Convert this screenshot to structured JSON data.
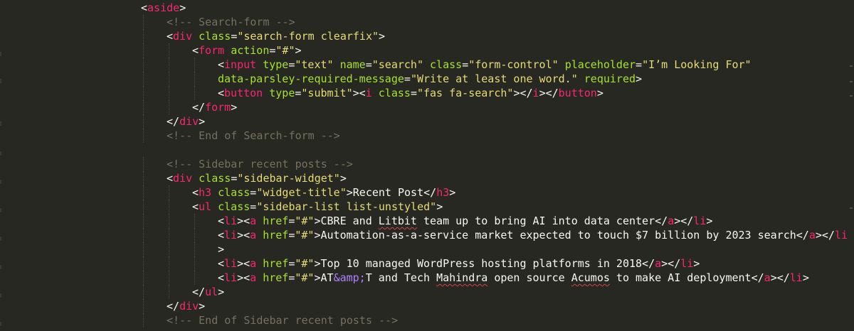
{
  "editor": {
    "theme_colors": {
      "background": "#272822",
      "tag": "#f92672",
      "attribute": "#a6e22e",
      "string": "#e6db74",
      "comment": "#75715e",
      "entity": "#ae81ff",
      "punctuation": "#f8f8f2"
    },
    "lines": [
      {
        "indent": 0,
        "tokens": [
          [
            "p",
            "<"
          ],
          [
            "t",
            "aside"
          ],
          [
            "p",
            ">"
          ]
        ]
      },
      {
        "indent": 1,
        "tokens": [
          [
            "c",
            "<!-- Search-form -->"
          ]
        ]
      },
      {
        "indent": 1,
        "tokens": [
          [
            "p",
            "<"
          ],
          [
            "t",
            "div"
          ],
          [
            "p",
            " "
          ],
          [
            "a",
            "class"
          ],
          [
            "p",
            "="
          ],
          [
            "s",
            "\"search-form clearfix\""
          ],
          [
            "p",
            ">"
          ]
        ]
      },
      {
        "indent": 2,
        "tokens": [
          [
            "p",
            "<"
          ],
          [
            "t",
            "form"
          ],
          [
            "p",
            " "
          ],
          [
            "a",
            "action"
          ],
          [
            "p",
            "="
          ],
          [
            "s",
            "\"#\""
          ],
          [
            "p",
            ">"
          ]
        ]
      },
      {
        "indent": 3,
        "tokens": [
          [
            "p",
            "<"
          ],
          [
            "t",
            "input"
          ],
          [
            "p",
            " "
          ],
          [
            "a",
            "type"
          ],
          [
            "p",
            "="
          ],
          [
            "s",
            "\"text\""
          ],
          [
            "p",
            " "
          ],
          [
            "a",
            "name"
          ],
          [
            "p",
            "="
          ],
          [
            "s",
            "\"search\""
          ],
          [
            "p",
            " "
          ],
          [
            "a",
            "class"
          ],
          [
            "p",
            "="
          ],
          [
            "s",
            "\"form-control\""
          ],
          [
            "p",
            " "
          ],
          [
            "a",
            "placeholder"
          ],
          [
            "p",
            "="
          ],
          [
            "s",
            "\"I’m Looking For\""
          ]
        ]
      },
      {
        "indent": 3,
        "tokens": [
          [
            "a",
            "data-parsley-required-message"
          ],
          [
            "p",
            "="
          ],
          [
            "s",
            "\"Write at least one word.\""
          ],
          [
            "p",
            " "
          ],
          [
            "a",
            "required"
          ],
          [
            "p",
            ">"
          ]
        ]
      },
      {
        "indent": 3,
        "tokens": [
          [
            "p",
            "<"
          ],
          [
            "t",
            "button"
          ],
          [
            "p",
            " "
          ],
          [
            "a",
            "type"
          ],
          [
            "p",
            "="
          ],
          [
            "s",
            "\"submit\""
          ],
          [
            "p",
            "><"
          ],
          [
            "t",
            "i"
          ],
          [
            "p",
            " "
          ],
          [
            "a",
            "class"
          ],
          [
            "p",
            "="
          ],
          [
            "s",
            "\"fas fa-search\""
          ],
          [
            "p",
            "></"
          ],
          [
            "t",
            "i"
          ],
          [
            "p",
            "></"
          ],
          [
            "t",
            "button"
          ],
          [
            "p",
            ">"
          ]
        ]
      },
      {
        "indent": 2,
        "tokens": [
          [
            "p",
            "</"
          ],
          [
            "t",
            "form"
          ],
          [
            "p",
            ">"
          ]
        ]
      },
      {
        "indent": 1,
        "tokens": [
          [
            "p",
            "</"
          ],
          [
            "t",
            "div"
          ],
          [
            "p",
            ">"
          ]
        ]
      },
      {
        "indent": 1,
        "tokens": [
          [
            "c",
            "<!-- End of Search-form -->"
          ]
        ]
      },
      {
        "indent": 0,
        "tokens": []
      },
      {
        "indent": 1,
        "tokens": [
          [
            "c",
            "<!-- Sidebar recent posts -->"
          ]
        ]
      },
      {
        "indent": 1,
        "tokens": [
          [
            "p",
            "<"
          ],
          [
            "t",
            "div"
          ],
          [
            "p",
            " "
          ],
          [
            "a",
            "class"
          ],
          [
            "p",
            "="
          ],
          [
            "s",
            "\"sidebar-widget\""
          ],
          [
            "p",
            ">"
          ]
        ]
      },
      {
        "indent": 2,
        "tokens": [
          [
            "p",
            "<"
          ],
          [
            "t",
            "h3"
          ],
          [
            "p",
            " "
          ],
          [
            "a",
            "class"
          ],
          [
            "p",
            "="
          ],
          [
            "s",
            "\"widget-title\""
          ],
          [
            "p",
            ">Recent Post</"
          ],
          [
            "t",
            "h3"
          ],
          [
            "p",
            ">"
          ]
        ]
      },
      {
        "indent": 2,
        "tokens": [
          [
            "p",
            "<"
          ],
          [
            "t",
            "ul"
          ],
          [
            "p",
            " "
          ],
          [
            "a",
            "class"
          ],
          [
            "p",
            "="
          ],
          [
            "s",
            "\"sidebar-list list-unstyled\""
          ],
          [
            "p",
            ">"
          ]
        ]
      },
      {
        "indent": 3,
        "tokens": [
          [
            "p",
            "<"
          ],
          [
            "t",
            "li"
          ],
          [
            "p",
            "><"
          ],
          [
            "t",
            "a"
          ],
          [
            "p",
            " "
          ],
          [
            "a",
            "href"
          ],
          [
            "p",
            "="
          ],
          [
            "s",
            "\"#\""
          ],
          [
            "p",
            ">CBRE and "
          ],
          [
            "pw",
            "Litbit"
          ],
          [
            "p",
            " team up to bring AI into data center</"
          ],
          [
            "t",
            "a"
          ],
          [
            "p",
            "></"
          ],
          [
            "t",
            "li"
          ],
          [
            "p",
            ">"
          ]
        ]
      },
      {
        "indent": 3,
        "tokens": [
          [
            "p",
            "<"
          ],
          [
            "t",
            "li"
          ],
          [
            "p",
            "><"
          ],
          [
            "t",
            "a"
          ],
          [
            "p",
            " "
          ],
          [
            "a",
            "href"
          ],
          [
            "p",
            "="
          ],
          [
            "s",
            "\"#\""
          ],
          [
            "p",
            ">Automation-as-a-service market expected to touch $7 billion by 2023 search</"
          ],
          [
            "t",
            "a"
          ],
          [
            "p",
            "></"
          ],
          [
            "t",
            "li"
          ]
        ]
      },
      {
        "indent": 3,
        "tokens": [
          [
            "p",
            ">"
          ]
        ]
      },
      {
        "indent": 3,
        "tokens": [
          [
            "p",
            "<"
          ],
          [
            "t",
            "li"
          ],
          [
            "p",
            "><"
          ],
          [
            "t",
            "a"
          ],
          [
            "p",
            " "
          ],
          [
            "a",
            "href"
          ],
          [
            "p",
            "="
          ],
          [
            "s",
            "\"#\""
          ],
          [
            "p",
            ">Top 10 managed WordPress hosting platforms in 2018</"
          ],
          [
            "t",
            "a"
          ],
          [
            "p",
            "></"
          ],
          [
            "t",
            "li"
          ],
          [
            "p",
            ">"
          ]
        ]
      },
      {
        "indent": 3,
        "tokens": [
          [
            "p",
            "<"
          ],
          [
            "t",
            "li"
          ],
          [
            "p",
            "><"
          ],
          [
            "t",
            "a"
          ],
          [
            "p",
            " "
          ],
          [
            "a",
            "href"
          ],
          [
            "p",
            "="
          ],
          [
            "s",
            "\"#\""
          ],
          [
            "p",
            ">AT"
          ],
          [
            "e",
            "&amp;"
          ],
          [
            "p",
            "T and Tech "
          ],
          [
            "pw",
            "Mahindra"
          ],
          [
            "p",
            " open source "
          ],
          [
            "pw",
            "Acumos"
          ],
          [
            "p",
            " to make AI deployment</"
          ],
          [
            "t",
            "a"
          ],
          [
            "p",
            "></"
          ],
          [
            "t",
            "li"
          ],
          [
            "p",
            ">"
          ]
        ]
      },
      {
        "indent": 2,
        "tokens": [
          [
            "p",
            "</"
          ],
          [
            "t",
            "ul"
          ],
          [
            "p",
            ">"
          ]
        ]
      },
      {
        "indent": 1,
        "tokens": [
          [
            "p",
            "</"
          ],
          [
            "t",
            "div"
          ],
          [
            "p",
            ">"
          ]
        ]
      },
      {
        "indent": 1,
        "tokens": [
          [
            "c",
            "<!-- End of Sidebar recent posts -->"
          ]
        ]
      }
    ]
  }
}
